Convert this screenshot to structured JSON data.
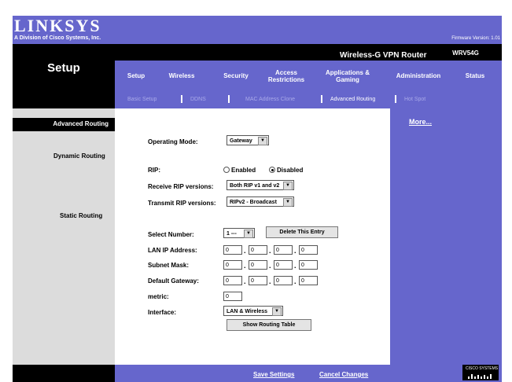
{
  "brand": {
    "logo": "LINKSYS",
    "tagline": "A Division of Cisco Systems, Inc.",
    "firmware": "Firmware Version: 1.01",
    "product": "Wireless-G VPN Router",
    "model": "WRV54G"
  },
  "page_title": "Setup",
  "tabs": [
    {
      "label": "Setup"
    },
    {
      "label": "Wireless"
    },
    {
      "label": "Security"
    },
    {
      "label": "Access\nRestrictions"
    },
    {
      "label": "Applications &\nGaming"
    },
    {
      "label": "Administration"
    },
    {
      "label": "Status"
    }
  ],
  "subtabs": [
    "Basic Setup",
    "DDNS",
    "MAC Address Clone",
    "Advanced Routing",
    "Hot Spot"
  ],
  "left": {
    "heading": "Advanced Routing",
    "dynamic": "Dynamic Routing",
    "static": "Static Routing"
  },
  "more": "More...",
  "form": {
    "operating_mode_label": "Operating Mode:",
    "operating_mode": "Gateway",
    "rip_label": "RIP:",
    "rip_enabled": "Enabled",
    "rip_disabled": "Disabled",
    "receive_label": "Receive RIP versions:",
    "receive": "Both RIP v1 and v2",
    "transmit_label": "Transmit RIP versions:",
    "transmit": "RIPv2 - Broadcast",
    "select_number_label": "Select Number:",
    "select_number": "1 ---",
    "delete_entry": "Delete This Entry",
    "lan_ip_label": "LAN IP Address:",
    "lan_ip": [
      "0",
      "0",
      "0",
      "0"
    ],
    "subnet_label": "Subnet Mask:",
    "subnet": [
      "0",
      "0",
      "0",
      "0"
    ],
    "gateway_label": "Default Gateway:",
    "gateway": [
      "0",
      "0",
      "0",
      "0"
    ],
    "metric_label": "metric:",
    "metric": "0",
    "interface_label": "Interface:",
    "interface": "LAN & Wireless",
    "show_table": "Show Routing Table"
  },
  "footer": {
    "save": "Save Settings",
    "cancel": "Cancel Changes"
  },
  "cisco": "CISCO SYSTEMS"
}
